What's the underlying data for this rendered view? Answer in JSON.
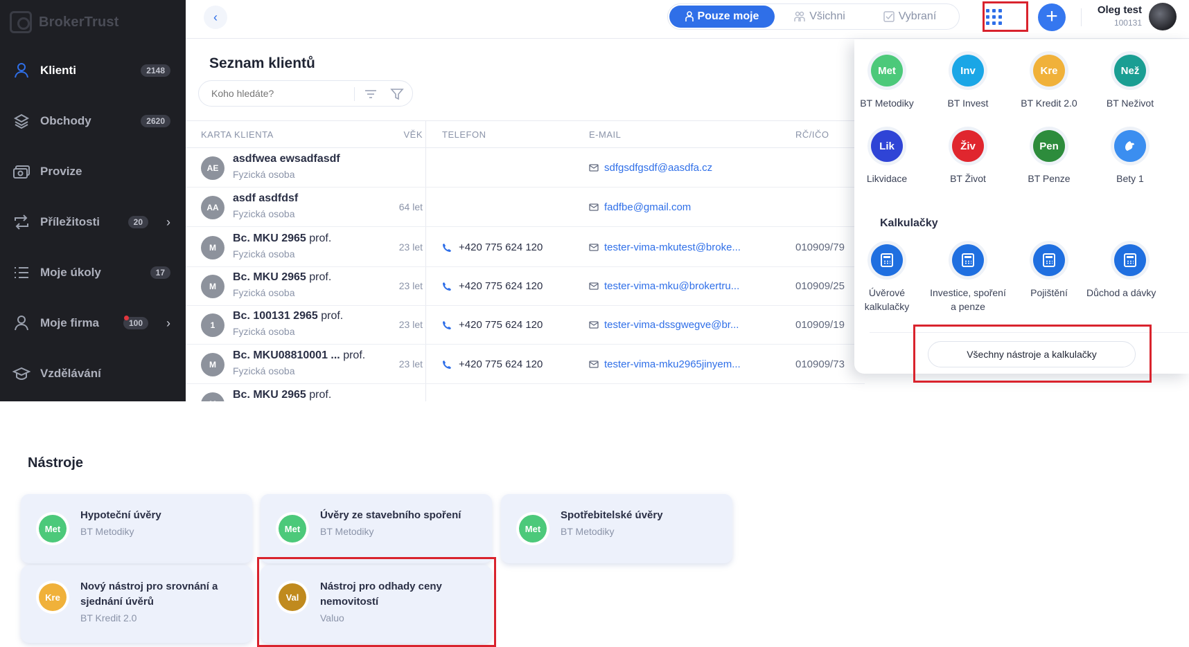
{
  "app": {
    "logo_text": "BrokerTrust"
  },
  "sidebar": {
    "items": [
      {
        "label": "Klienti",
        "count": "2148",
        "icon": "person-icon"
      },
      {
        "label": "Obchody",
        "count": "2620",
        "icon": "layers-icon"
      },
      {
        "label": "Provize",
        "count": "",
        "icon": "money-icon"
      },
      {
        "label": "Příležitosti",
        "count": "20",
        "icon": "repeat-icon"
      },
      {
        "label": "Moje úkoly",
        "count": "17",
        "icon": "list-icon"
      },
      {
        "label": "Moje firma",
        "count": "100",
        "icon": "person-icon"
      },
      {
        "label": "Vzdělávání",
        "count": "",
        "icon": "graduation-cap-icon"
      }
    ]
  },
  "topbar": {
    "segments": [
      "Pouze moje",
      "Všichni",
      "Vybraní"
    ],
    "user_name": "Oleg test",
    "user_id": "100131"
  },
  "clients": {
    "title": "Seznam klientů",
    "search_placeholder": "Koho hledáte?",
    "columns": [
      "KARTA KLIENTA",
      "VĚK",
      "TELEFON",
      "E-MAIL",
      "RČ/IČO"
    ],
    "rows": [
      {
        "initials": "AE",
        "name": "asdfwea ewsadfasdf",
        "title": "",
        "type": "Fyzická osoba",
        "age": "",
        "phone": "",
        "email": "sdfgsdfgsdf@aasdfa.cz",
        "rc": ""
      },
      {
        "initials": "AA",
        "name": "asdf asdfdsf",
        "title": "",
        "type": "Fyzická osoba",
        "age": "64 let",
        "phone": "",
        "email": "fadfbe@gmail.com",
        "rc": ""
      },
      {
        "initials": "M",
        "name": "Bc. MKU 2965",
        "title": "prof.",
        "type": "Fyzická osoba",
        "age": "23 let",
        "phone": "+420 775 624 120",
        "email": "tester-vima-mkutest@broke...",
        "rc": "010909/79"
      },
      {
        "initials": "M",
        "name": "Bc. MKU 2965",
        "title": "prof.",
        "type": "Fyzická osoba",
        "age": "23 let",
        "phone": "+420 775 624 120",
        "email": "tester-vima-mku@brokertru...",
        "rc": "010909/25"
      },
      {
        "initials": "1",
        "name": "Bc. 100131 2965",
        "title": "prof.",
        "type": "Fyzická osoba",
        "age": "23 let",
        "phone": "+420 775 624 120",
        "email": "tester-vima-dssgwegve@br...",
        "rc": "010909/19"
      },
      {
        "initials": "M",
        "name": "Bc. MKU08810001 ...",
        "title": "prof.",
        "type": "Fyzická osoba",
        "age": "23 let",
        "phone": "+420 775 624 120",
        "email": "tester-vima-mku2965jinyem...",
        "rc": "010909/73"
      },
      {
        "initials": "M",
        "name": "Bc. MKU 2965",
        "title": "prof.",
        "type": "",
        "age": "",
        "phone": "",
        "email": "",
        "rc": ""
      }
    ]
  },
  "apps_panel": {
    "tools": [
      {
        "abbr": "Met",
        "label": "BT Metodiky",
        "color": "#4cc97a"
      },
      {
        "abbr": "Inv",
        "label": "BT Invest",
        "color": "#1aa6e6"
      },
      {
        "abbr": "Kre",
        "label": "BT Kredit 2.0",
        "color": "#f0b13a"
      },
      {
        "abbr": "Než",
        "label": "BT Neživot",
        "color": "#1a9e93"
      },
      {
        "abbr": "Lik",
        "label": "Likvidace",
        "color": "#2f44d6"
      },
      {
        "abbr": "Živ",
        "label": "BT Život",
        "color": "#e0262e"
      },
      {
        "abbr": "Pen",
        "label": "BT Penze",
        "color": "#2d8c3c"
      },
      {
        "abbr": "",
        "label": "Bety 1",
        "color": "#3b8ef0"
      }
    ],
    "calc_title": "Kalkulačky",
    "calculators": [
      {
        "label": "Úvěrové kalkulačky",
        "color": "#1f6fe0"
      },
      {
        "label": "Investice, spoření a penze",
        "color": "#1f6fe0"
      },
      {
        "label": "Pojištění",
        "color": "#1f6fe0"
      },
      {
        "label": "Důchod a dávky",
        "color": "#1f6fe0"
      }
    ],
    "all_tools_label": "Všechny nástroje a kalkulačky"
  },
  "tools_section": {
    "title": "Nástroje",
    "cards": [
      {
        "abbr": "Met",
        "title": "Hypoteční úvěry",
        "source": "BT Metodiky",
        "color": "#4cc97a"
      },
      {
        "abbr": "Met",
        "title": "Úvěry ze stavebního spoření",
        "source": "BT Metodiky",
        "color": "#4cc97a"
      },
      {
        "abbr": "Met",
        "title": "Spotřebitelské úvěry",
        "source": "BT Metodiky",
        "color": "#4cc97a"
      },
      {
        "abbr": "Kre",
        "title": "Nový nástroj pro srovnání a sjednání úvěrů",
        "source": "BT Kredit 2.0",
        "color": "#f0b13a"
      },
      {
        "abbr": "Val",
        "title": "Nástroj pro odhady ceny nemovitostí",
        "source": "Valuo",
        "color": "#c08a1e"
      }
    ]
  }
}
